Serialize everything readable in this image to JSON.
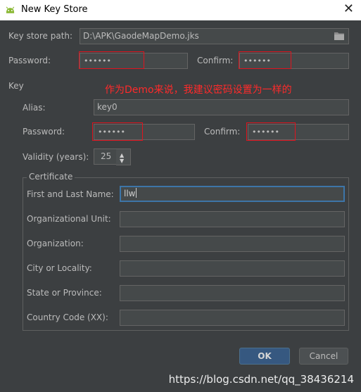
{
  "window": {
    "title": "New Key Store",
    "close_glyph": "✕"
  },
  "keystore": {
    "path_label": "Key store path:",
    "path_value": "D:\\APK\\GaodeMapDemo.jks",
    "password_label": "Password:",
    "password_value": "••••••",
    "confirm_label": "Confirm:",
    "confirm_value": "••••••"
  },
  "key": {
    "section_label": "Key",
    "alias_label": "Alias:",
    "alias_value": "key0",
    "password_label": "Password:",
    "password_value": "••••••",
    "confirm_label": "Confirm:",
    "confirm_value": "••••••",
    "validity_label": "Validity (years):",
    "validity_value": "25"
  },
  "annotation": "作为Demo来说，我建议密码设置为一样的",
  "certificate": {
    "title": "Certificate",
    "first_last_label": "First and Last Name:",
    "first_last_value": "llw",
    "org_unit_label": "Organizational Unit:",
    "org_unit_value": "",
    "org_label": "Organization:",
    "org_value": "",
    "city_label": "City or Locality:",
    "city_value": "",
    "state_label": "State or Province:",
    "state_value": "",
    "country_label": "Country Code (XX):",
    "country_value": ""
  },
  "buttons": {
    "ok": "OK",
    "cancel": "Cancel"
  },
  "watermark": "https://blog.csdn.net/qq_38436214",
  "colors": {
    "background": "#3c3f41",
    "field": "#45494a",
    "ok_button": "#365880",
    "annotation": "#e0141e",
    "focus_border": "#3d75a8"
  },
  "icons": {
    "app": "android-icon",
    "folder": "folder-icon",
    "spinner": "spinner-arrows-icon"
  }
}
